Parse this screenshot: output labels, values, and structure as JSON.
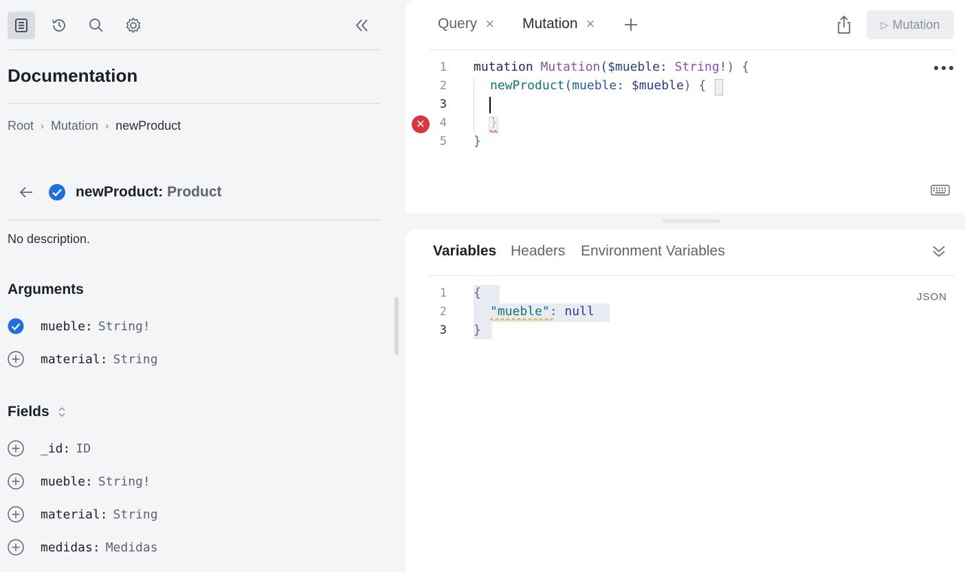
{
  "sidebar": {
    "title": "Documentation",
    "breadcrumb": [
      "Root",
      "Mutation",
      "newProduct"
    ],
    "field": {
      "name": "newProduct:",
      "type": "Product"
    },
    "description": "No description.",
    "arguments_title": "Arguments",
    "arguments": [
      {
        "name": "mueble:",
        "type": "String!",
        "selected": true
      },
      {
        "name": "material:",
        "type": "String",
        "selected": false
      }
    ],
    "fields_title": "Fields",
    "fields": [
      {
        "name": "_id:",
        "type": "ID"
      },
      {
        "name": "mueble:",
        "type": "String!"
      },
      {
        "name": "material:",
        "type": "String"
      },
      {
        "name": "medidas:",
        "type": "Medidas"
      }
    ]
  },
  "editor": {
    "tabs": [
      "Query",
      "Mutation"
    ],
    "run_label": "Mutation",
    "line_numbers": [
      "1",
      "2",
      "3",
      "4",
      "5"
    ],
    "code": {
      "l1_kw": "mutation",
      "l1_name": "Mutation",
      "l1_var": "($mueble:",
      "l1_type": "String",
      "l1_end": "!) {",
      "l2_field": "newProduct",
      "l2_arg": "(mueble:",
      "l2_var": "$mueble",
      "l2_end": ") {",
      "l4": "}",
      "l5": "}"
    }
  },
  "variables": {
    "tabs": [
      "Variables",
      "Headers",
      "Environment Variables"
    ],
    "active_tab": "Variables",
    "line_numbers": [
      "1",
      "2",
      "3"
    ],
    "json_badge": "JSON",
    "code": {
      "l1": "{",
      "l2_key": "\"mueble\"",
      "l2_colon": ":",
      "l2_val": "null",
      "l3": "}"
    }
  },
  "colors": {
    "accent_check": "#1f6ee0",
    "error": "#d9363e"
  }
}
